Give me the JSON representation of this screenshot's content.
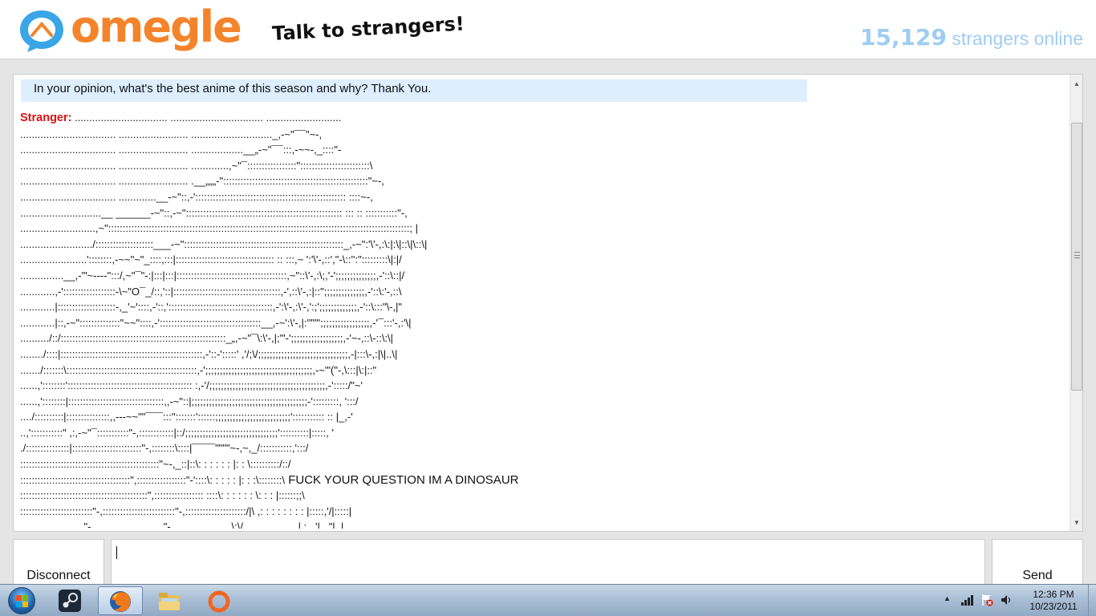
{
  "header": {
    "logo_text": "omegle",
    "tagline": "Talk to strangers!",
    "online_count": "15,129",
    "online_label": " strangers online"
  },
  "chat": {
    "question": "In your opinion, what's the best anime of this season and why? Thank You.",
    "stranger_label": "Stranger:",
    "first_line": " ................................ ................................ ..........................",
    "art_lines": [
      "................................. ........................ ............................_,-~\"¯¯\"~-,",
      "................................. ........................ ..................__„-~\"¯¯:::,-~~-,_::::\"-",
      "................................. ........................ .............,~\"¯:::::::::::::::::\"::::::::::::::::::::::::\\",
      "................................. ........................ .__„„„-\"::::::::::::::::::::::::::::::::::::::::::::::::::\"~-,",
      "................................. .............__-~\"::,-':::::::::::::::::::::::::::::::::::::::::::::::::::: ::::~-,",
      "............................__ ______-~\"::,-~\":::::::::::::::::::::::::::::::::::::::::::::::::::::: ::: :: :::::::::::\"-,",
      "..........................,~\"::::::::::::::::::::::::::::::::::::::::::::::::::::::::::::::::::::::::::::::::::::::::::::::::::::::::; |",
      "........................./::::::::::::::::::::___-~\":::::::::::::::::::::::::::::::::::::::::::::::::::::::_,-~\":'\\'-,:\\:|:\\|::\\|\\::\\|",
      ".......................'::::::::,-~~\"~\"_::::,:::|:::::::::::::::::::::::::::::::::: :: :::,~ ':'\\'-,::',\"-\\::'':\":::::::::\\|:|/",
      "...............__,-'\"~----\":::/,~\"¯\"-:|:::|:::|::::::::::::::::::::::::::::::::::::::,~\"::\\'-,:\\;,'-';;;;;;;;;;;;;;,-'::\\::|/",
      "............,-'::::::::::::::::::-\\~\"O¯_/::,'::|:::::::::::::::::::::::::::::::::::::,-',::\\'-,:|::\";;;;;;;;;;;;;;,-'::\\:'-,::\\",
      "............|::::::::::::::::::::-,_'~'::::,-'::,'::::::::::::::::::::::::::::::::::::,-':\\'-,:\\'-,':;';;;;;;;;;;;;;,-'::\\:::\"\\-,|\"",
      "............|::,-~\"::::::::::::::\"~~\"::::,-':::::::::::::::::::::::::::::::::::__,-~':\\'-,|:''\"\"';;;;;;;;;;;;;;;;;,-'¯:::'-,:'\\|",
      "........../::/:::::::::::::::::::::::::::::::::::::::::::::::::::::::::_„,-~\"¯\\:\\'-,|;'\"-';;;;;;;;;;;;;;;;;;,-'~-,::\\-::\\:\\|",
      "......../::::|:::::::::::::::::::::::::::::::::::::::::::::::::,-'::-':::::' ,'/;\\/;;;;;;;;;;;;;;;;;;;;;;;;;;;;;;;,-|:::\\-,:|\\|..\\|",
      "......./:::::::\\:::::::::::::::::::::::::::::::::::::::::::::,-';;;;;;;;;;;;;;;;;;;;;;;;;;;;;;;;;;;;;,-~'\"(\"-,\\:::|\\:|::\"",
      "......,'::::::::'::::::::::::::::::::::::::::::::::::::::::: :,-'/;;;;;;;;;;;;;;;;;;;;;;;;;;;;;;;;;;;;;;;;,-':::::/\"~'",
      "......,'::::::::|:::::::::::::::::::::::::::::::::,,-~\"::|;;;;;;;;;;;;;;;;;;;;;;;;;;;;;;;;;;;;;;;;-':::::::::, ':::/",
      "..../::::::::::|:::::::::::::::,,---~~\"\"¯¯¯:::'':::::::'::::::;;;;;;;;;;;;;;;;;;;;;;;;;;'::::::::::: :: |_,-'",
      "..,':::::::::::\" ,:,-~\"¯:::::::::::\"-,::::::::::::|::/;;;;;;;;;;;;;;;;;;;;;;;;;;;;;;;;'::::::::::|:::::, '",
      "./:::::::::::::::|::::::::::::::::::::::::\"-,::::::::\\::::|¯¯¯¯\"\"\"\"~-,~,_/:::::::::::,':::/",
      "::::::::::::::::::::::::::::::::::::::::::::::::\"~-,_::|::\\: : : : : : |: : \\::::::::::/::/",
      "::::::::::::::::::::::::::::::::::::::\",:::::::::::::::::\"-'::::\\: : : : : |: : :\\::::::::\\"
    ],
    "shout": " FUCK YOUR QUESTION IM A DINOSAUR",
    "art_tail": [
      "::::::::::::::::::::::::::::::::::::::::::::\",::::::::::::::::: ::::\\: : : : : : \\: : : |::::::;;\\",
      ":::::::::::::::::::::::::\"-,:::::::::::::::::::::::::\"-,:::::::::::::::::::::/|\\ ,: : : : : : : : |:::::,'/|:::::|",
      "......................\"-,........................\"-,....................\\:\\/...................|.:...'|...\"|..|"
    ]
  },
  "controls": {
    "disconnect": "Disconnect",
    "send": "Send",
    "input_value": ""
  },
  "taskbar": {
    "time": "12:36 PM",
    "date": "10/23/2011"
  }
}
